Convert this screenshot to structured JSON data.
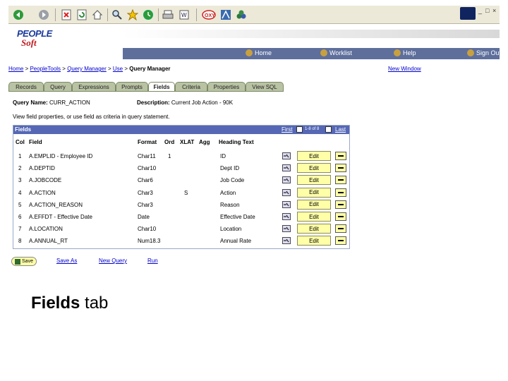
{
  "browser": {
    "toolbar_icons": [
      "back-icon",
      "forward-icon",
      "stop-icon",
      "refresh-icon",
      "home-icon",
      "search-icon",
      "favorites-icon",
      "history-icon",
      "print-icon",
      "edit-icon",
      "oxy-icon",
      "toolkit-icon",
      "messenger-icon"
    ],
    "window_controls": [
      "_",
      "□",
      "×"
    ],
    "accent": "#5e6f9c"
  },
  "header": {
    "logo_line1": "PEOPLE",
    "logo_line2": "Soft",
    "nav": [
      {
        "label": "Home",
        "icon": "home-icon"
      },
      {
        "label": "Worklist",
        "icon": "worklist-icon"
      },
      {
        "label": "Help",
        "icon": "help-icon"
      },
      {
        "label": "Sign Out",
        "icon": "signout-icon"
      }
    ]
  },
  "breadcrumb": {
    "items": [
      "Home",
      "PeopleTools",
      "Query Manager",
      "Use"
    ],
    "current": "Query Manager",
    "sep": " > ",
    "new_window": "New Window"
  },
  "tabs": [
    "Records",
    "Query",
    "Expressions",
    "Prompts",
    "Fields",
    "Criteria",
    "Properties",
    "View SQL"
  ],
  "active_tab": "Fields",
  "query": {
    "name_label": "Query Name:",
    "name_value": "CURR_ACTION",
    "desc_label": "Description:",
    "desc_value": "Current Job Action - 90K",
    "instruction": "View field properties, or use field as criteria in query statement."
  },
  "grid": {
    "title": "Fields",
    "first": "First",
    "count": "1-8 of 8",
    "last": "Last",
    "columns": [
      "Col",
      "Field",
      "Format",
      "Ord",
      "XLAT",
      "Agg",
      "Heading Text"
    ],
    "edit_label": "Edit",
    "rows": [
      {
        "col": "1",
        "field": "A.EMPLID - Employee ID",
        "format": "Char11",
        "ord": "1",
        "xlat": "",
        "agg": "",
        "heading": "ID"
      },
      {
        "col": "2",
        "field": "A.DEPTID",
        "format": "Char10",
        "ord": "",
        "xlat": "",
        "agg": "",
        "heading": "Dept ID"
      },
      {
        "col": "3",
        "field": "A.JOBCODE",
        "format": "Char6",
        "ord": "",
        "xlat": "",
        "agg": "",
        "heading": "Job Code"
      },
      {
        "col": "4",
        "field": "A.ACTION",
        "format": "Char3",
        "ord": "",
        "xlat": "S",
        "agg": "",
        "heading": "Action"
      },
      {
        "col": "5",
        "field": "A.ACTION_REASON",
        "format": "Char3",
        "ord": "",
        "xlat": "",
        "agg": "",
        "heading": "Reason"
      },
      {
        "col": "6",
        "field": "A.EFFDT - Effective Date",
        "format": "Date",
        "ord": "",
        "xlat": "",
        "agg": "",
        "heading": "Effective Date"
      },
      {
        "col": "7",
        "field": "A.LOCATION",
        "format": "Char10",
        "ord": "",
        "xlat": "",
        "agg": "",
        "heading": "Location"
      },
      {
        "col": "8",
        "field": "A.ANNUAL_RT",
        "format": "Num18.3",
        "ord": "",
        "xlat": "",
        "agg": "",
        "heading": "Annual Rate"
      }
    ]
  },
  "actions": {
    "save": "Save",
    "save_as": "Save As",
    "new_query": "New Query",
    "run": "Run"
  },
  "caption": {
    "bold": "Fields",
    "rest": " tab"
  }
}
